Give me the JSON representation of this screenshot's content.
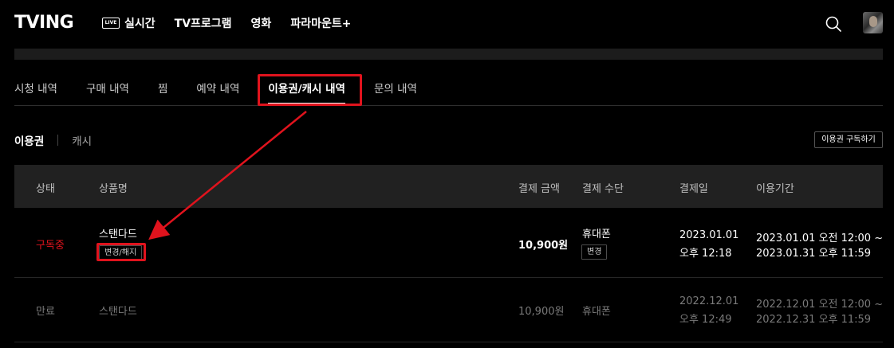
{
  "header": {
    "logo": "TVING",
    "live_badge": "LIVE",
    "nav": [
      "실시간",
      "TV프로그램",
      "영화",
      "파라마운트+"
    ],
    "icons": {
      "search": "search-icon",
      "profile": "avatar"
    }
  },
  "tabs": [
    "시청 내역",
    "구매 내역",
    "찜",
    "예약 내역",
    "이용권/캐시 내역",
    "문의 내역"
  ],
  "active_tab": "이용권/캐시 내역",
  "subtabs": {
    "pass": "이용권",
    "cash": "캐시",
    "subscribe_button": "이용권 구독하기"
  },
  "table": {
    "headers": {
      "status": "상태",
      "product": "상품명",
      "amount": "결제 금액",
      "method": "결제 수단",
      "date": "결제일",
      "period": "이용기간"
    },
    "rows": [
      {
        "status": "구독중",
        "product": "스탠다드",
        "product_button": "변경/해지",
        "amount": "10,900원",
        "method": "휴대폰",
        "method_button": "변경",
        "date_line1": "2023.01.01",
        "date_line2": "오후 12:18",
        "period_line1": "2023.01.01 오전 12:00 ~",
        "period_line2": "2023.01.31 오후 11:59"
      },
      {
        "status": "만료",
        "product": "스탠다드",
        "amount": "10,900원",
        "method": "휴대폰",
        "date_line1": "2022.12.01",
        "date_line2": "오후 12:49",
        "period_line1": "2022.12.01 오전 12:00 ~",
        "period_line2": "2022.12.31 오후 11:59"
      }
    ]
  },
  "colors": {
    "accent": "#e0131d",
    "background": "#000000",
    "header_row": "#212121"
  }
}
